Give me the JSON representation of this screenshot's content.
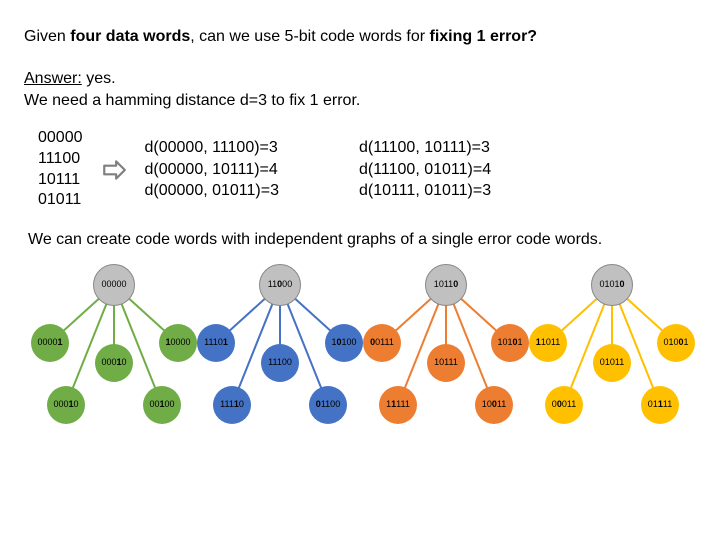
{
  "question": {
    "p1": "Given ",
    "b1": "four data words",
    "p2": ", can we use 5-bit code words for ",
    "b2": "fixing 1 error?"
  },
  "answer": {
    "label": "Answer:",
    "val": " yes."
  },
  "explain": "We need a hamming distance d=3 to fix 1 error.",
  "words": {
    "w0": "00000",
    "w1": "11100",
    "w2": "10111",
    "w3": "01011"
  },
  "d": {
    "l0": "d(00000, 11100)=3",
    "l1": "d(00000, 10111)=4",
    "l2": "d(00000, 01011)=3",
    "r0": "d(11100, 10111)=3",
    "r1": "d(11100, 01011)=4",
    "r2": "d(10111, 01011)=3"
  },
  "create": "We can create code words with independent graphs of a single error code words.",
  "colors": {
    "green": "#70ad47",
    "blue": "#4472c4",
    "red": "#ed7d31",
    "orange": "#ffc000"
  },
  "graphs": [
    {
      "center": {
        "label": "00000",
        "mask": [
          0,
          0,
          0,
          0,
          0
        ]
      },
      "leaves": [
        {
          "color": "green",
          "label": "00001",
          "mask": [
            0,
            0,
            0,
            0,
            1
          ]
        },
        {
          "color": "green",
          "label": "10000",
          "mask": [
            1,
            0,
            0,
            0,
            0
          ]
        },
        {
          "color": "green",
          "label": "00010",
          "mask": [
            0,
            0,
            0,
            1,
            0
          ]
        },
        {
          "color": "green",
          "label": "00010",
          "mask": [
            0,
            0,
            0,
            1,
            0
          ]
        },
        {
          "color": "green",
          "label": "00100",
          "mask": [
            0,
            0,
            1,
            0,
            0
          ]
        }
      ]
    },
    {
      "center": {
        "label": "11000",
        "mask": [
          0,
          0,
          1,
          0,
          0
        ]
      },
      "leaves": [
        {
          "color": "blue",
          "label": "11101",
          "mask": [
            0,
            0,
            0,
            0,
            1
          ]
        },
        {
          "color": "blue",
          "label": "10100",
          "mask": [
            0,
            1,
            0,
            0,
            0
          ]
        },
        {
          "color": "blue",
          "label": "11100",
          "mask": [
            0,
            0,
            0,
            0,
            0
          ]
        },
        {
          "color": "blue",
          "label": "11110",
          "mask": [
            0,
            0,
            0,
            1,
            0
          ]
        },
        {
          "color": "blue",
          "label": "01100",
          "mask": [
            1,
            0,
            0,
            0,
            0
          ]
        }
      ]
    },
    {
      "center": {
        "label": "10110",
        "mask": [
          0,
          0,
          0,
          0,
          1
        ]
      },
      "leaves": [
        {
          "color": "red",
          "label": "00111",
          "mask": [
            1,
            0,
            0,
            0,
            0
          ]
        },
        {
          "color": "red",
          "label": "10101",
          "mask": [
            0,
            0,
            0,
            1,
            0
          ]
        },
        {
          "color": "red",
          "label": "10111",
          "mask": [
            0,
            0,
            0,
            0,
            0
          ]
        },
        {
          "color": "red",
          "label": "11111",
          "mask": [
            0,
            1,
            0,
            0,
            0
          ]
        },
        {
          "color": "red",
          "label": "10011",
          "mask": [
            0,
            0,
            1,
            0,
            0
          ]
        }
      ]
    },
    {
      "center": {
        "label": "01010",
        "mask": [
          0,
          0,
          0,
          0,
          1
        ]
      },
      "leaves": [
        {
          "color": "orange",
          "label": "11011",
          "mask": [
            1,
            0,
            0,
            0,
            0
          ]
        },
        {
          "color": "orange",
          "label": "01001",
          "mask": [
            0,
            0,
            0,
            1,
            0
          ]
        },
        {
          "color": "orange",
          "label": "01011",
          "mask": [
            0,
            0,
            0,
            0,
            0
          ]
        },
        {
          "color": "orange",
          "label": "00011",
          "mask": [
            0,
            1,
            0,
            0,
            0
          ]
        },
        {
          "color": "orange",
          "label": "01111",
          "mask": [
            0,
            0,
            1,
            0,
            0
          ]
        }
      ]
    }
  ]
}
